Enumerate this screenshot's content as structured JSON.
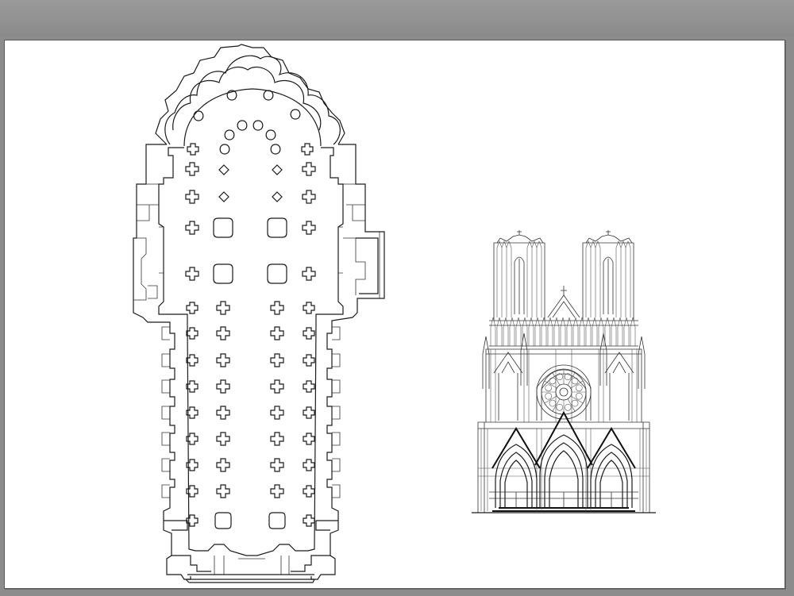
{
  "viewer": {
    "background_color": "#8c8c8c",
    "sheet_color": "#ffffff",
    "line_color": "#1a1a1a"
  },
  "drawing": {
    "views": [
      "cathedral-floor-plan",
      "cathedral-west-facade-elevation"
    ]
  }
}
